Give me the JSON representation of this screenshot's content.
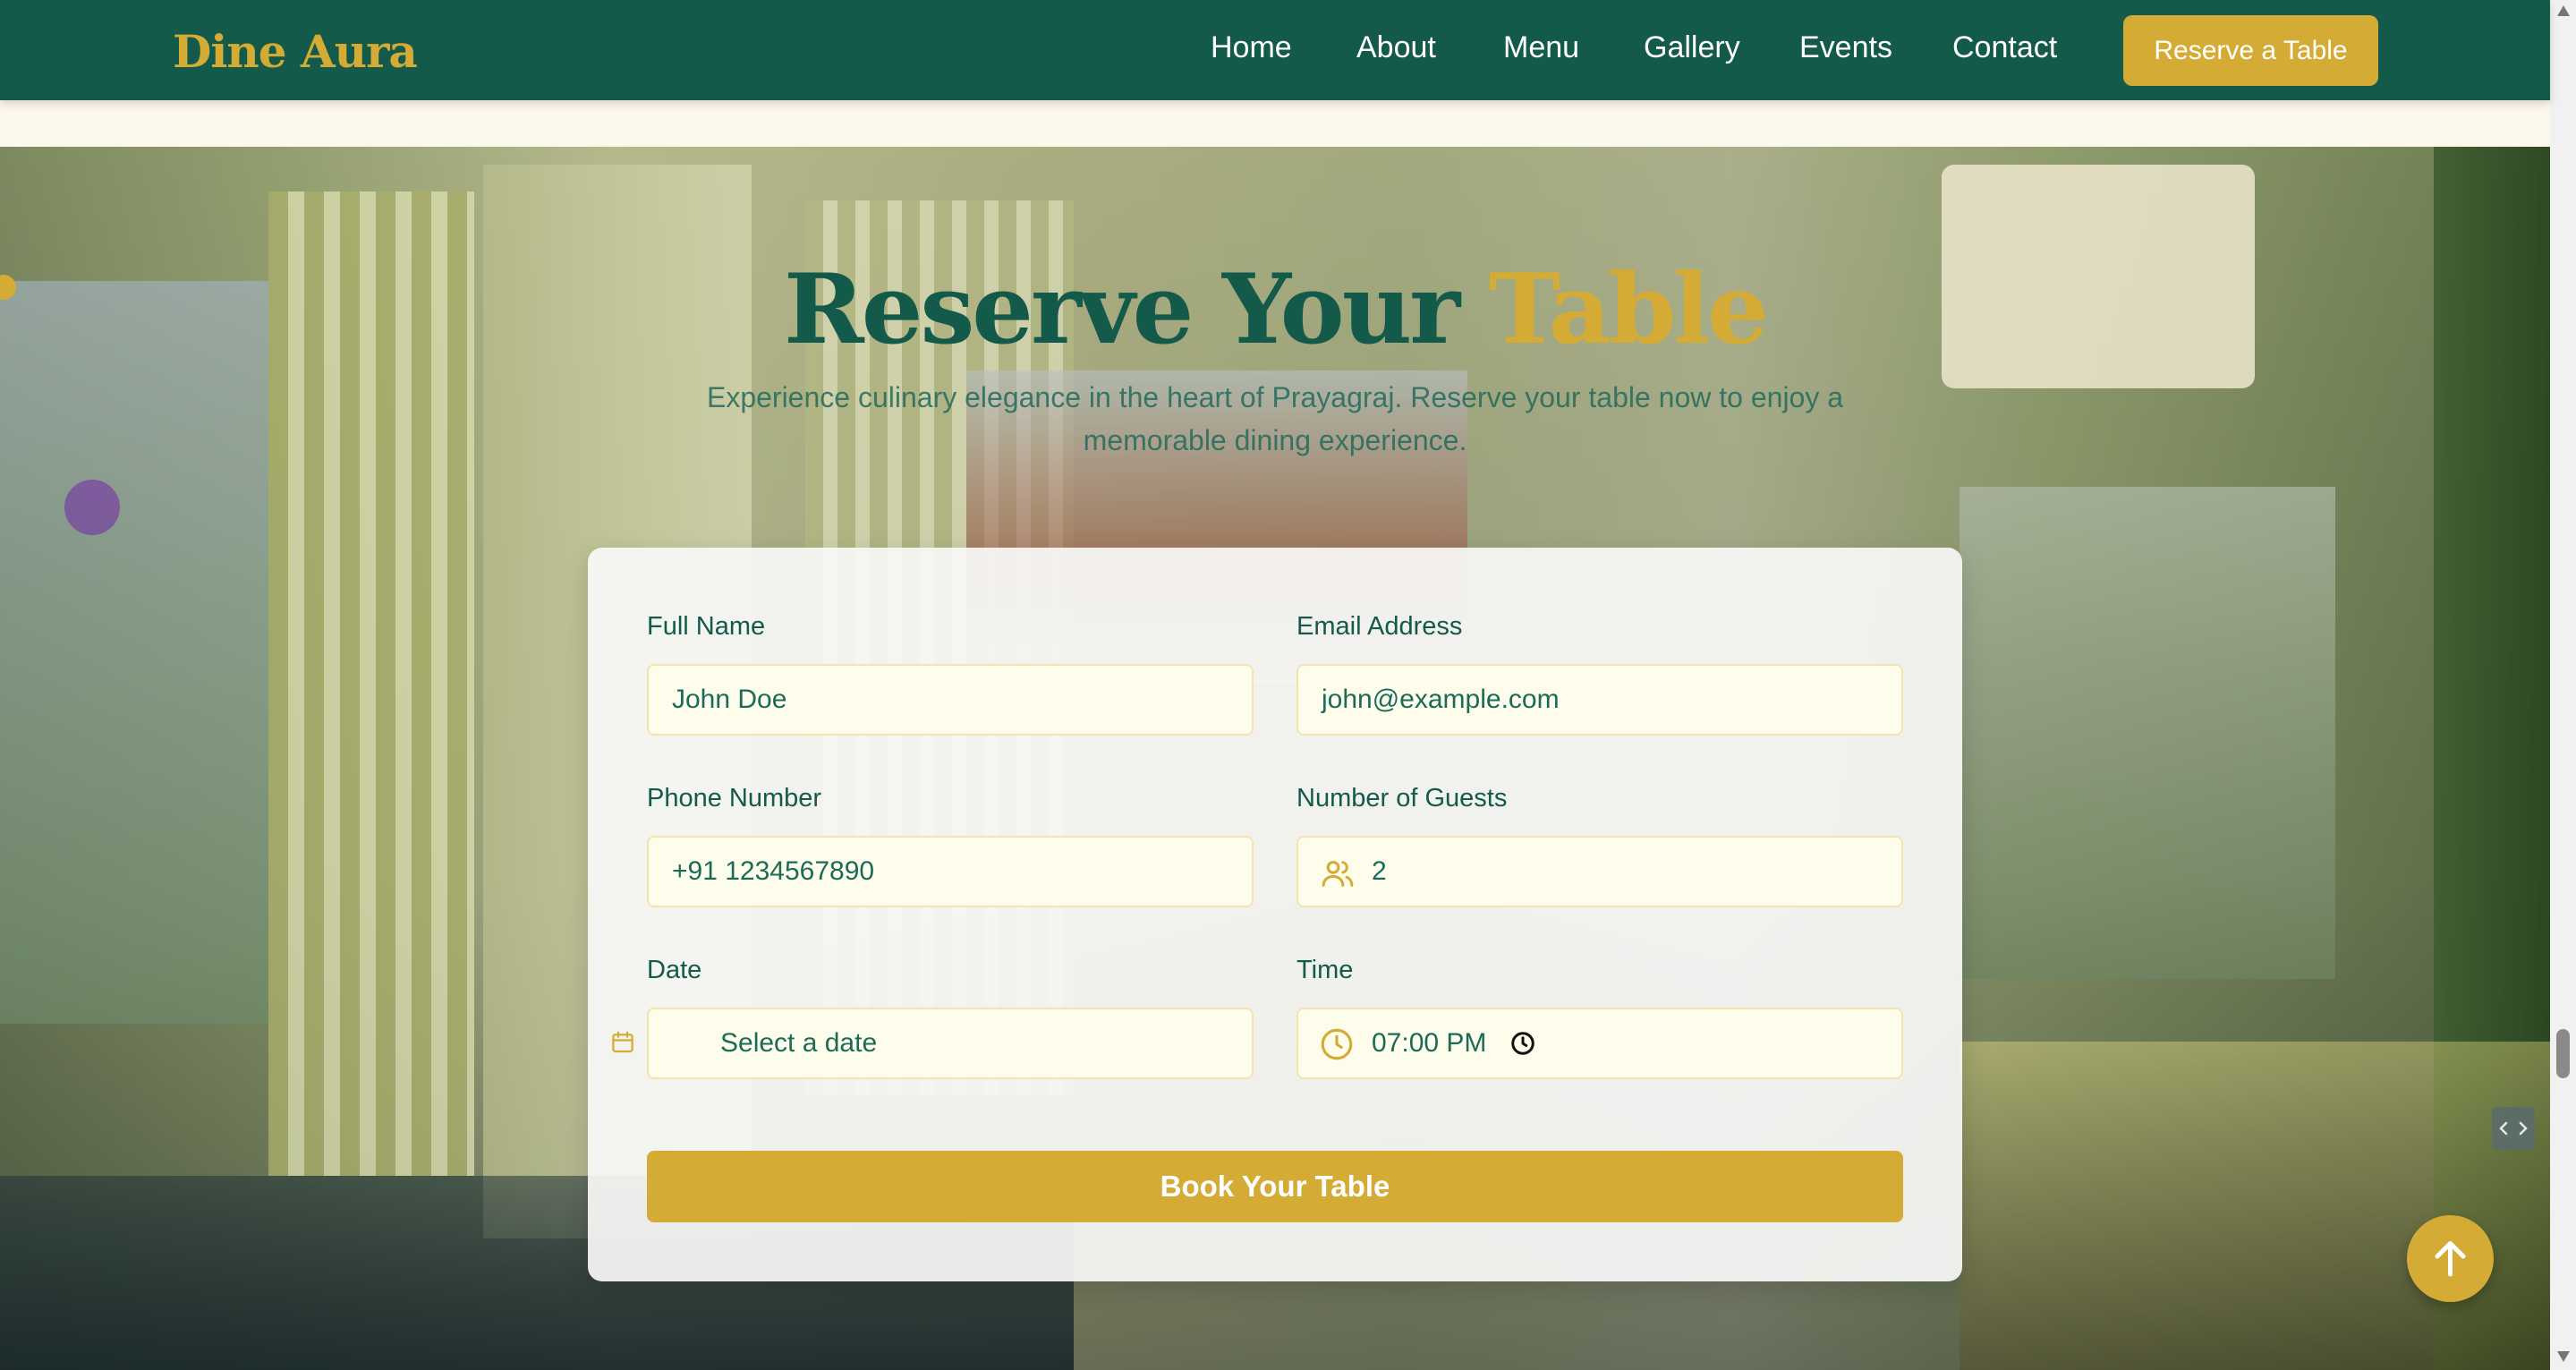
{
  "brand": {
    "name": "Dine Aura"
  },
  "nav": {
    "links": [
      "Home",
      "About",
      "Menu",
      "Gallery",
      "Events",
      "Contact"
    ],
    "cta_label": "Reserve a Table"
  },
  "hero": {
    "title_part1": "Reserve Your",
    "title_part2": "Table",
    "subtitle": "Experience culinary elegance in the heart of Prayagraj. Reserve your table now to enjoy a memorable dining experience."
  },
  "form": {
    "full_name": {
      "label": "Full Name",
      "value": "John Doe"
    },
    "email": {
      "label": "Email Address",
      "value": "john@example.com"
    },
    "phone": {
      "label": "Phone Number",
      "value": "+91 1234567890"
    },
    "guests": {
      "label": "Number of Guests",
      "value": "2",
      "icon": "users-icon"
    },
    "date": {
      "label": "Date",
      "placeholder": "Select a date",
      "icon": "calendar-icon"
    },
    "time": {
      "label": "Time",
      "value": "07:00 PM",
      "icon": "clock-icon"
    },
    "submit_label": "Book Your Table"
  },
  "colors": {
    "brand_green": "#145a4b",
    "brand_gold": "#d4ac35",
    "field_bg": "#fefdec"
  }
}
